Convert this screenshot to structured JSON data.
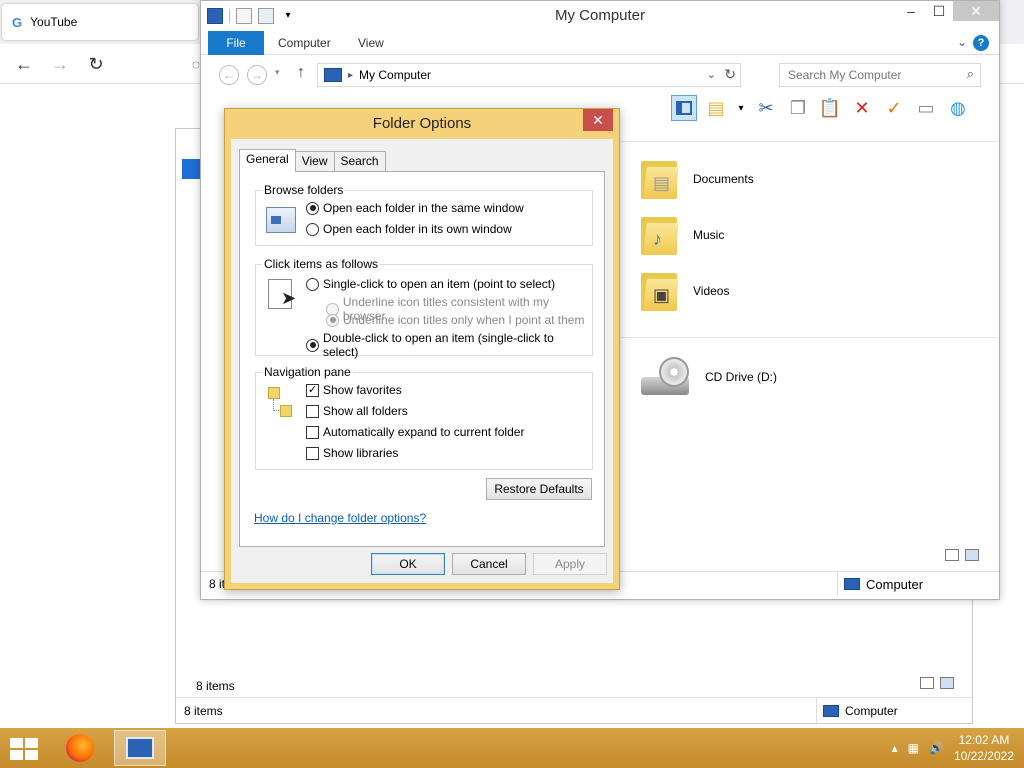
{
  "browser": {
    "tab_title": "YouTube",
    "tab_favicon": "G"
  },
  "back_window": {
    "status_items": "8 items",
    "status_items_bottom": "8 items",
    "status_location": "Computer"
  },
  "explorer": {
    "title": "My Computer",
    "ribbon_tabs": [
      "File",
      "Computer",
      "View"
    ],
    "address": "My Computer",
    "search_placeholder": "Search My Computer",
    "items": [
      {
        "name": "Documents",
        "icon": "documents-folder-icon"
      },
      {
        "name": "Music",
        "icon": "music-folder-icon"
      },
      {
        "name": "Videos",
        "icon": "videos-folder-icon"
      },
      {
        "name": "CD Drive (D:)",
        "icon": "cd-drive-icon"
      }
    ],
    "status_items": "8 items",
    "status_location": "Computer"
  },
  "dialog": {
    "title": "Folder Options",
    "tabs": [
      "General",
      "View",
      "Search"
    ],
    "browse_folders": {
      "label": "Browse folders",
      "options": [
        "Open each folder in the same window",
        "Open each folder in its own window"
      ],
      "selected": 0
    },
    "click_items": {
      "label": "Click items as follows",
      "single_click": "Single-click to open an item (point to select)",
      "underline_browser": "Underline icon titles consistent with my browser",
      "underline_point": "Underline icon titles only when I point at them",
      "double_click": "Double-click to open an item (single-click to select)",
      "selected": "double_click"
    },
    "navigation_pane": {
      "label": "Navigation pane",
      "show_favorites": "Show favorites",
      "show_all_folders": "Show all folders",
      "auto_expand": "Automatically expand to current folder",
      "show_libraries": "Show libraries",
      "checked": {
        "show_favorites": true,
        "show_all_folders": false,
        "auto_expand": false,
        "show_libraries": false
      }
    },
    "restore_defaults": "Restore Defaults",
    "help_link": "How do I change folder options?",
    "ok": "OK",
    "cancel": "Cancel",
    "apply": "Apply"
  },
  "taskbar": {
    "time": "12:02 AM",
    "date": "10/22/2022"
  },
  "colors": {
    "accent": "#1979ca",
    "taskbar": "#c58a2a",
    "dialog_frame": "#f5d27a",
    "close_button": "#c7504b"
  }
}
